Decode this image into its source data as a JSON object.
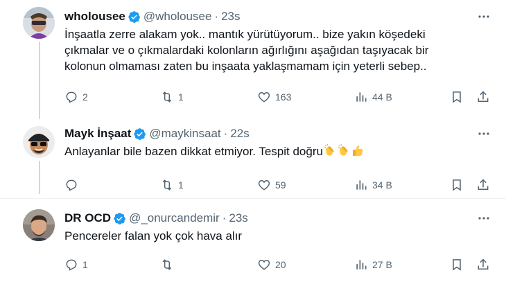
{
  "tweets": [
    {
      "name": "wholousee",
      "handle": "@wholousee",
      "time": "23s",
      "lines": [
        "İnşaatla zerre alakam yok.. mantık yürütüyorum.. bize yakın köşedeki",
        "çıkmalar ve o çıkmalardaki kolonların ağırlığını aşağıdan taşıyacak bir",
        "kolonun olmaması zaten bu inşaata yaklaşmamam için yeterli sebep.."
      ],
      "replies": "2",
      "retweets": "1",
      "likes": "163",
      "views": "44 B"
    },
    {
      "name": "Mayk İnşaat",
      "handle": "@maykinsaat",
      "time": "22s",
      "lines": [
        "Anlayanlar bile bazen dikkat etmiyor. Tespit doğru"
      ],
      "emojis": [
        "clapping-hands",
        "clapping-hands",
        "thumbs-up"
      ],
      "replies": "",
      "retweets": "1",
      "likes": "59",
      "views": "34 B"
    },
    {
      "name": "DR OCD",
      "handle": "@_onurcandemir",
      "time": "23s",
      "lines": [
        "Pencereler falan yok çok hava alır"
      ],
      "replies": "1",
      "retweets": "",
      "likes": "20",
      "views": "27 B"
    }
  ],
  "dot_separator": "·",
  "colors": {
    "verified": "#1d9bf0",
    "secondary_text": "#536471",
    "thread_line": "#cfd9de",
    "emoji_yellow": "#ffc83d"
  }
}
